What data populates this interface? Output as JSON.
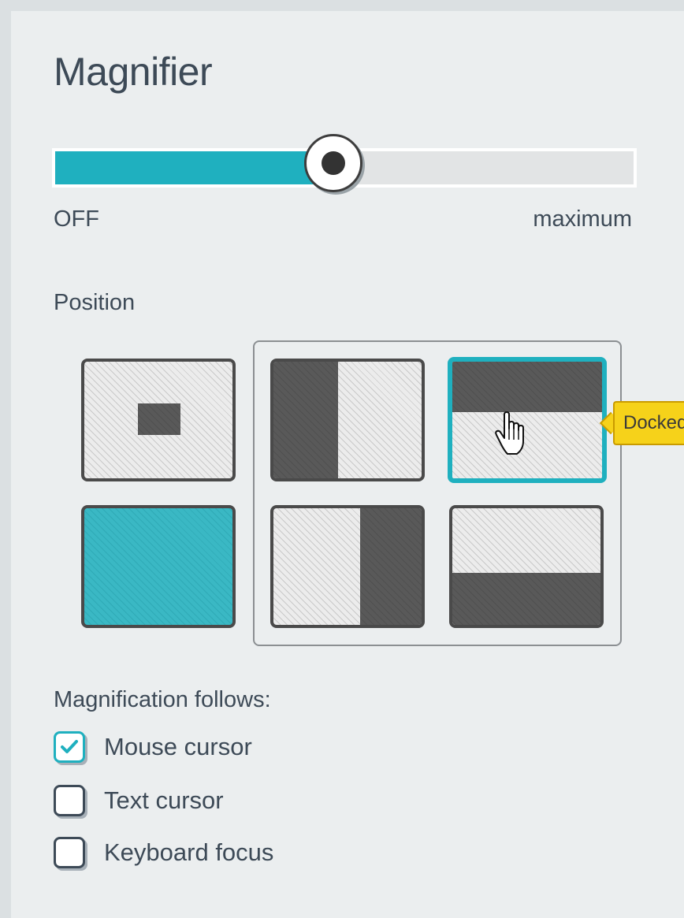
{
  "title": "Magnifier",
  "slider": {
    "min_label": "OFF",
    "max_label": "maximum",
    "value_fraction": 0.48
  },
  "position": {
    "label": "Position",
    "tooltip": "Docked",
    "options": [
      {
        "name": "lens",
        "selected": false
      },
      {
        "name": "docked-left",
        "selected": false
      },
      {
        "name": "docked-top",
        "selected": true
      },
      {
        "name": "full-screen",
        "selected": false
      },
      {
        "name": "docked-right",
        "selected": false
      },
      {
        "name": "docked-bottom",
        "selected": false
      }
    ]
  },
  "follows": {
    "label": "Magnification follows:",
    "options": [
      {
        "label": "Mouse cursor",
        "checked": true
      },
      {
        "label": "Text cursor",
        "checked": false
      },
      {
        "label": "Keyboard focus",
        "checked": false
      }
    ]
  },
  "colors": {
    "accent": "#1fb0bf",
    "text": "#3d4a57",
    "tooltip": "#f6d21a"
  }
}
